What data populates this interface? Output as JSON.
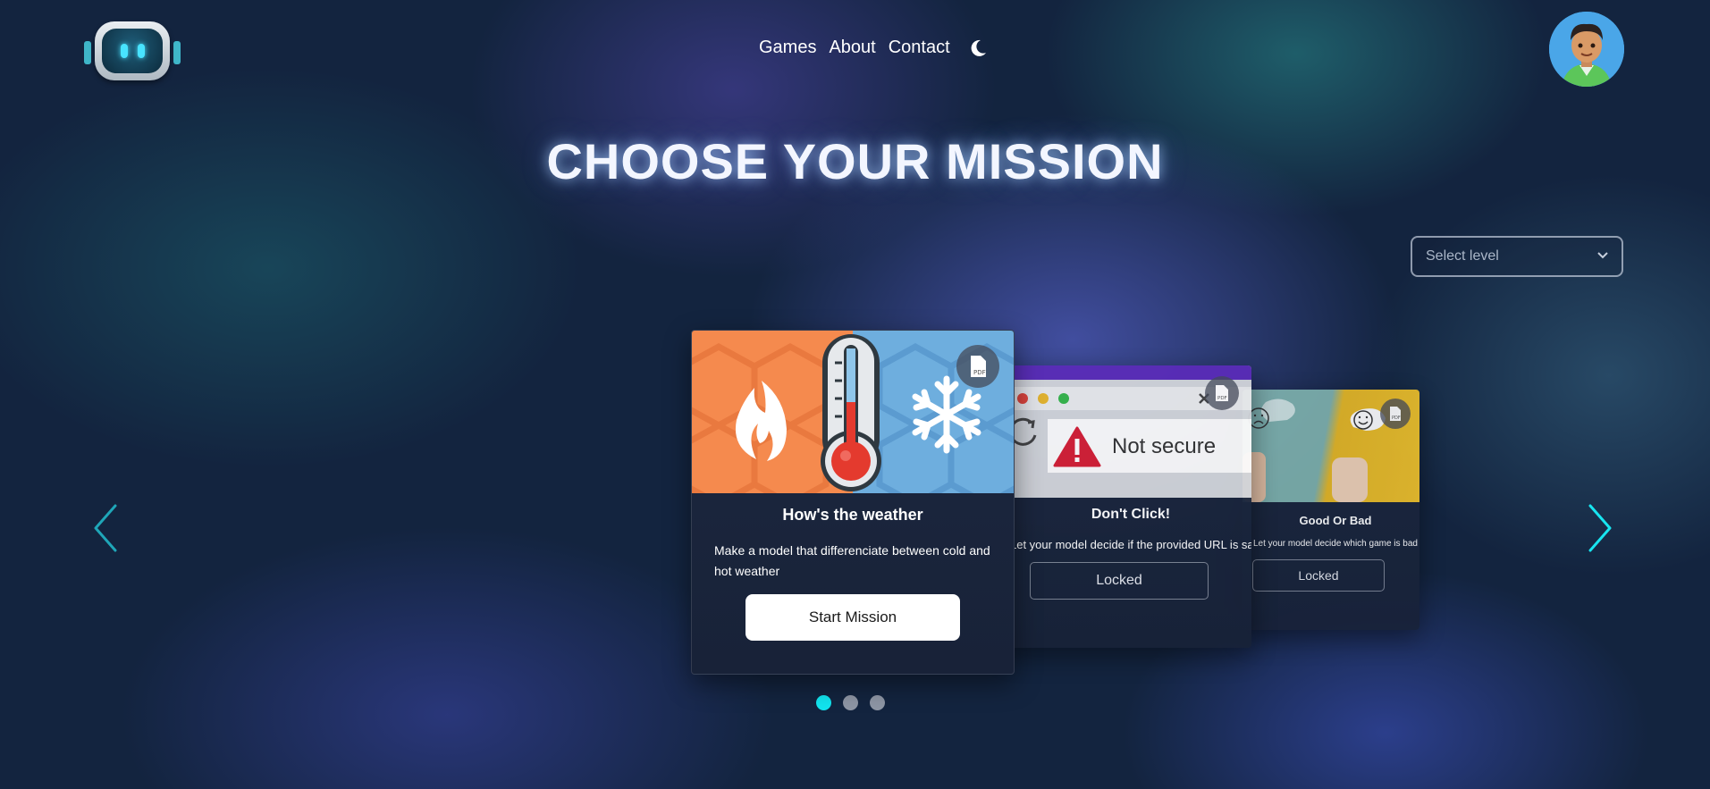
{
  "header": {
    "nav": [
      {
        "label": "Games"
      },
      {
        "label": "About"
      },
      {
        "label": "Contact"
      }
    ],
    "theme_toggle_icon": "moon-icon",
    "logo_icon": "robot-icon",
    "avatar_icon": "user-avatar"
  },
  "page": {
    "title": "CHOOSE YOUR MISSION"
  },
  "level_select": {
    "placeholder": "Select level",
    "icon": "chevron-down-icon"
  },
  "carousel": {
    "cards": [
      {
        "title": "How's the weather",
        "description": "Make a model that differenciate between cold and hot weather",
        "button": "Start Mission",
        "state": "unlocked"
      },
      {
        "title": "Don't Click!",
        "description": "Let your model decide if the provided URL is safe.",
        "button": "Locked",
        "image_text": "Not secure",
        "state": "locked"
      },
      {
        "title": "Good Or Bad",
        "description": "Let your model decide which game is bad",
        "button": "Locked",
        "state": "locked"
      }
    ],
    "pages": 3,
    "active_page": 1
  },
  "colors": {
    "accent": "#12e5f0",
    "background": "#13243f",
    "card": "#1c2840",
    "locked_card_bar": "#5a2cb8"
  }
}
